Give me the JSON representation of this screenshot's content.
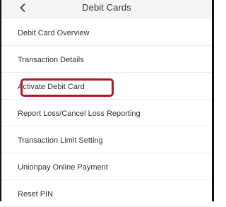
{
  "header": {
    "back_icon": "chevron-left-icon",
    "title": "Debit Cards"
  },
  "menu": {
    "items": [
      {
        "label": "Debit Card Overview"
      },
      {
        "label": "Transaction Details"
      },
      {
        "label": "Activate Debit Card",
        "highlighted": true
      },
      {
        "label": "Report Loss/Cancel Loss Reporting"
      },
      {
        "label": "Transaction Limit Setting"
      },
      {
        "label": "Unionpay Online Payment"
      },
      {
        "label": "Reset PIN"
      }
    ]
  },
  "colors": {
    "header_bg": "#f4f4f4",
    "highlight_border": "#b0162a",
    "text": "#333333",
    "divider": "#ececec"
  }
}
